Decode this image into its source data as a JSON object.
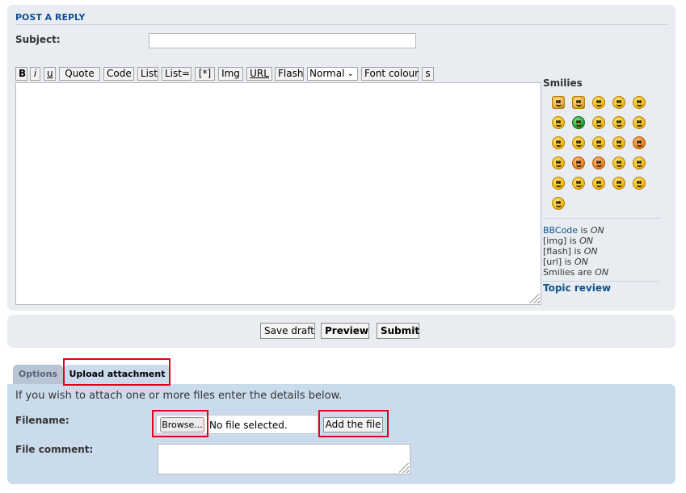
{
  "post": {
    "heading": "POST A REPLY",
    "subject_label": "Subject:",
    "subject_value": "",
    "toolbar": {
      "bold": "B",
      "italic": "i",
      "underline": "u",
      "quote": "Quote",
      "code": "Code",
      "list": "List",
      "list_eq": "List=",
      "list_item": "[*]",
      "img": "Img",
      "url": "URL",
      "flash": "Flash",
      "font_size": "Normal",
      "font_colour": "Font colour",
      "s": "s"
    },
    "message_value": ""
  },
  "sidebar": {
    "smilies_title": "Smilies",
    "smilies": [
      "thumbs-up-smiley-icon",
      "thumbs-down-smiley-icon",
      "grin-smiley-icon",
      "smile-smiley-icon",
      "wink-smiley-icon",
      "neutral-smiley-icon",
      "green-grin-smiley-icon",
      "surprised-smiley-icon",
      "eek-smiley-icon",
      "confused-smiley-icon",
      "cool-smiley-icon",
      "laughing-smiley-icon",
      "mad-smiley-icon",
      "razz-smiley-icon",
      "embarrassed-smiley-icon",
      "cry-smiley-icon",
      "evil-smiley-icon",
      "twisted-smiley-icon",
      "rolleyes-smiley-icon",
      "exclaim-smiley-icon",
      "question-smiley-icon",
      "idea-smiley-icon",
      "arrow-smiley-icon",
      "sad-smiley-icon",
      "geek-smiley-icon",
      "uber-geek-smiley-icon"
    ],
    "bbcode_link": "BBCode",
    "bbcode_rest": " is ",
    "on": "ON",
    "img_status_label": "[img] is ",
    "flash_status_label": "[flash] is ",
    "url_status_label": "[url] is ",
    "smilies_status_label": "Smilies are ",
    "topic_review": "Topic review"
  },
  "actions": {
    "save_draft": "Save draft",
    "preview": "Preview",
    "submit": "Submit"
  },
  "tabs": {
    "options": "Options",
    "upload": "Upload attachment"
  },
  "attachment": {
    "intro": "If you wish to attach one or more files enter the details below.",
    "filename_label": "Filename:",
    "browse": "Browse...",
    "no_file": "No file selected.",
    "add_file": "Add the file",
    "comment_label": "File comment:",
    "comment_value": ""
  },
  "colors": {
    "panel": "#e9edf1",
    "attach_panel": "#cadceb",
    "link": "#105289",
    "highlight": "#e4001b"
  }
}
